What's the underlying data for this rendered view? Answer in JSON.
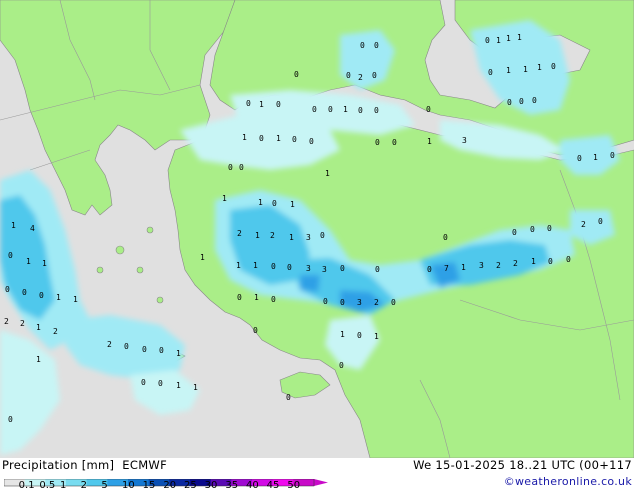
{
  "header": {
    "legend_title": "Precipitation [mm]",
    "model": "ECMWF",
    "run_info": "We 15-01-2025 18..21 UTC (00+117",
    "credit": "©weatheronline.co.uk"
  },
  "legend": {
    "ticks": [
      "0.1",
      "0.5",
      "1",
      "2",
      "5",
      "10",
      "15",
      "20",
      "25",
      "30",
      "35",
      "40",
      "45",
      "50"
    ],
    "colors": [
      "#e6e6e6",
      "#c8f5f5",
      "#a0eaf5",
      "#78dcf0",
      "#50c8ec",
      "#2da0e6",
      "#1478d2",
      "#0a50b4",
      "#0a28a0",
      "#0a0a8c",
      "#5a0ab4",
      "#a00ad2",
      "#d20ae6",
      "#f00aee",
      "#c80ac8"
    ]
  },
  "colors": {
    "land": "#aaee88",
    "sea": "#e0e0e0",
    "coast": "#888888"
  },
  "map": {
    "rain_labels": [
      {
        "t": "0"
      },
      {
        "t": "1"
      },
      {
        "t": "1"
      },
      {
        "t": "1"
      },
      {
        "t": "0"
      },
      {
        "t": "1"
      },
      {
        "t": "1"
      },
      {
        "t": "1"
      },
      {
        "t": "0"
      },
      {
        "t": "0"
      },
      {
        "t": "0"
      },
      {
        "t": "0"
      },
      {
        "t": "0"
      },
      {
        "t": "2"
      },
      {
        "t": "0"
      },
      {
        "t": "0"
      },
      {
        "t": "0"
      },
      {
        "t": "0"
      },
      {
        "t": "0"
      },
      {
        "t": "1"
      },
      {
        "t": "0"
      },
      {
        "t": "0"
      },
      {
        "t": "0"
      },
      {
        "t": "1"
      },
      {
        "t": "0"
      },
      {
        "t": "0"
      },
      {
        "t": "0"
      },
      {
        "t": "1"
      },
      {
        "t": "0"
      },
      {
        "t": "1"
      },
      {
        "t": "0"
      },
      {
        "t": "0"
      },
      {
        "t": "0"
      },
      {
        "t": "0"
      },
      {
        "t": "1"
      },
      {
        "t": "3"
      },
      {
        "t": "0"
      },
      {
        "t": "0"
      },
      {
        "t": "1"
      },
      {
        "t": "1"
      },
      {
        "t": "1"
      },
      {
        "t": "0"
      },
      {
        "t": "1"
      },
      {
        "t": "2"
      },
      {
        "t": "1"
      },
      {
        "t": "2"
      },
      {
        "t": "1"
      },
      {
        "t": "3"
      },
      {
        "t": "0"
      },
      {
        "t": "1"
      },
      {
        "t": "1"
      },
      {
        "t": "0"
      },
      {
        "t": "0"
      },
      {
        "t": "3"
      },
      {
        "t": "3"
      },
      {
        "t": "0"
      },
      {
        "t": "0"
      },
      {
        "t": "0"
      },
      {
        "t": "7"
      },
      {
        "t": "1"
      },
      {
        "t": "3"
      },
      {
        "t": "2"
      },
      {
        "t": "2"
      },
      {
        "t": "1"
      },
      {
        "t": "0"
      },
      {
        "t": "0"
      },
      {
        "t": "0"
      },
      {
        "t": "0"
      },
      {
        "t": "0"
      },
      {
        "t": "0"
      },
      {
        "t": "2"
      },
      {
        "t": "0"
      },
      {
        "t": "0"
      },
      {
        "t": "1"
      },
      {
        "t": "0"
      },
      {
        "t": "0"
      },
      {
        "t": "1"
      },
      {
        "t": "0"
      },
      {
        "t": "0"
      },
      {
        "t": "0"
      },
      {
        "t": "0"
      },
      {
        "t": "3"
      },
      {
        "t": "2"
      },
      {
        "t": "0"
      },
      {
        "t": "1"
      },
      {
        "t": "4"
      },
      {
        "t": "0"
      },
      {
        "t": "1"
      },
      {
        "t": "1"
      },
      {
        "t": "0"
      },
      {
        "t": "0"
      },
      {
        "t": "0"
      },
      {
        "t": "1"
      },
      {
        "t": "1"
      },
      {
        "t": "2"
      },
      {
        "t": "2"
      },
      {
        "t": "1"
      },
      {
        "t": "2"
      },
      {
        "t": "2"
      },
      {
        "t": "0"
      },
      {
        "t": "0"
      },
      {
        "t": "0"
      },
      {
        "t": "1"
      },
      {
        "t": "1"
      },
      {
        "t": "0"
      },
      {
        "t": "0"
      },
      {
        "t": "1"
      },
      {
        "t": "1"
      },
      {
        "t": "1"
      },
      {
        "t": "0"
      },
      {
        "t": "1"
      },
      {
        "t": "0"
      },
      {
        "t": "0"
      },
      {
        "t": "1"
      },
      {
        "t": "0"
      }
    ]
  }
}
